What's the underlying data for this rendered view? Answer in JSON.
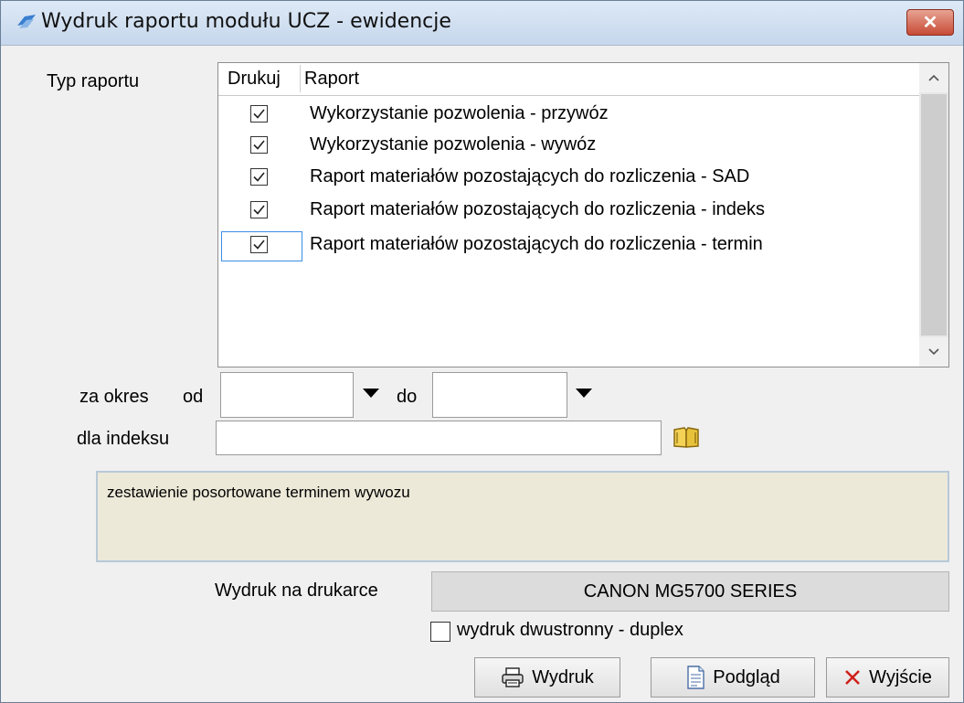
{
  "window": {
    "title": "Wydruk raportu modułu UCZ - ewidencje",
    "close_label": "✕"
  },
  "report_type": {
    "label": "Typ raportu",
    "columns": [
      "Drukuj",
      "Raport"
    ],
    "rows": [
      {
        "checked": true,
        "name": "Wykorzystanie pozwolenia - przywóz"
      },
      {
        "checked": true,
        "name": "Wykorzystanie pozwolenia - wywóz"
      },
      {
        "checked": true,
        "name": "Raport materiałów pozostających do rozliczenia - SAD"
      },
      {
        "checked": true,
        "name": "Raport materiałów pozostających do rozliczenia - indeks"
      },
      {
        "checked": true,
        "name": "Raport materiałów pozostających do rozliczenia - termin"
      }
    ]
  },
  "period": {
    "label": "za okres",
    "from_label": "od",
    "to_label": "do",
    "from_value": "",
    "to_value": ""
  },
  "index": {
    "label": "dla indeksu",
    "value": ""
  },
  "description": "zestawienie posortowane terminem wywozu",
  "printer": {
    "label": "Wydruk na drukarce",
    "name": "CANON MG5700 SERIES"
  },
  "duplex": {
    "label": "wydruk dwustronny - duplex",
    "checked": false
  },
  "buttons": {
    "print": "Wydruk",
    "preview": "Podgląd",
    "exit": "Wyjście"
  },
  "colors": {
    "description_bg": "#ece9d8",
    "close_button": "#c74a35",
    "exit_icon": "#d0201a"
  }
}
